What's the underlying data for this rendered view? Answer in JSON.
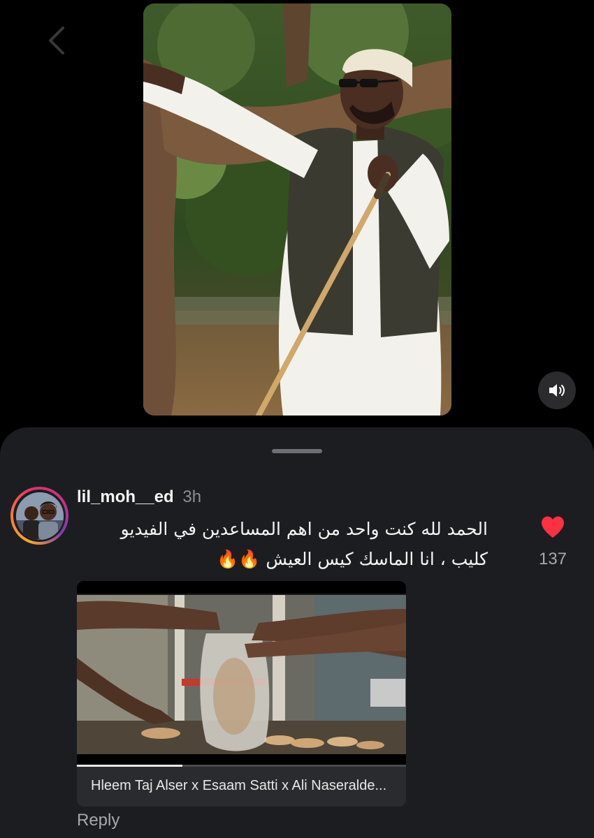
{
  "comment": {
    "username": "lil_moh__ed",
    "timestamp": "3h",
    "text_lines": [
      "الحمد لله كنت واحد من اهم المساعدين في الفيديو",
      "كليب ، انا الماسك كيس العيش 🔥🔥"
    ],
    "like_count": "137",
    "liked": true,
    "attachment": {
      "caption": "Hleem Taj Alser x Esaam Satti x Ali Naseralde...",
      "progress": 0.32
    },
    "reply_label": "Reply"
  },
  "icons": {
    "back": "chevron-left-icon",
    "sound": "speaker-icon",
    "like": "heart-icon"
  },
  "colors": {
    "background": "#000000",
    "sheet": "#1c1d20",
    "like": "#ff3040",
    "muted_text": "#a8a8ad",
    "story_ring": [
      "#f9a825",
      "#f77737",
      "#e1306c",
      "#c13584",
      "#833ab4"
    ]
  }
}
